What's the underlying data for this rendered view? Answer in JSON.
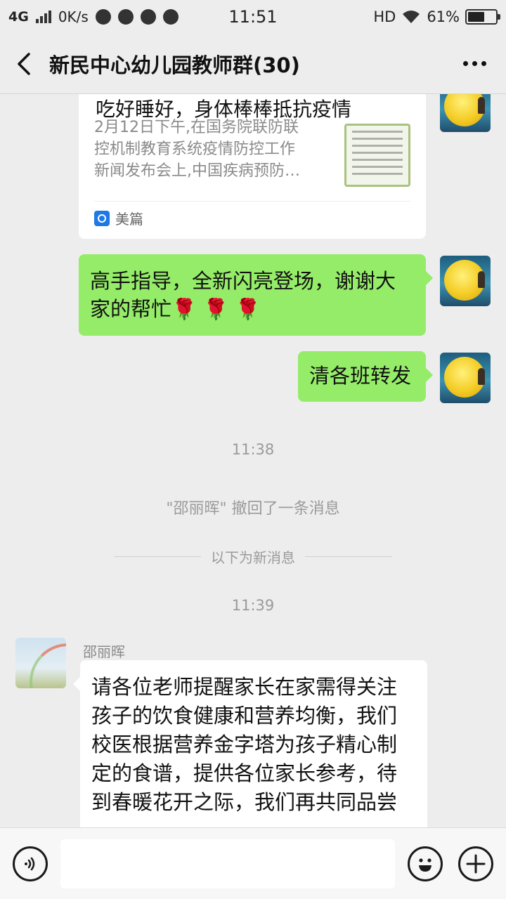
{
  "status_bar": {
    "network": "4G",
    "speed": "0K/s",
    "time": "11:51",
    "hd": "HD",
    "battery": "61%",
    "battery_level": 0.61
  },
  "header": {
    "title": "新民中心幼儿园教师群(30)"
  },
  "messages": {
    "card": {
      "title": "吃好睡好，身体棒棒抵抗疫情",
      "desc_lines": [
        "2月12日下午,在国务院联防联",
        "控机制教育系统疫情防控工作",
        "新闻发布会上,中国疾病预防…"
      ],
      "source": "美篇"
    },
    "out1": {
      "line1": "高手指导，全新闪亮登场，谢谢大",
      "line2": "家的帮忙",
      "flowers": "🌹 🌹 🌹"
    },
    "out2": {
      "text": "清各班转发"
    },
    "time1": "11:38",
    "recall": "\"邵丽晖\" 撤回了一条消息",
    "new_divider": "以下为新消息",
    "time2": "11:39",
    "in1": {
      "sender": "邵丽晖",
      "lines": [
        "请各位老师提醒家长在家需得关注",
        "孩子的饮食健康和营养均衡，我们",
        "校医根据营养金字塔为孩子精心制",
        "定的食谱，提供各位家长参考，待",
        "到春暖花开之际，我们再共同品尝"
      ]
    }
  },
  "colors": {
    "bubble_out": "#95ec69",
    "background": "#ededed"
  },
  "icons": {
    "back": "back-arrow-icon",
    "more": "more-dots-icon",
    "voice": "voice-icon",
    "emoji": "emoji-icon",
    "plus": "plus-icon"
  }
}
